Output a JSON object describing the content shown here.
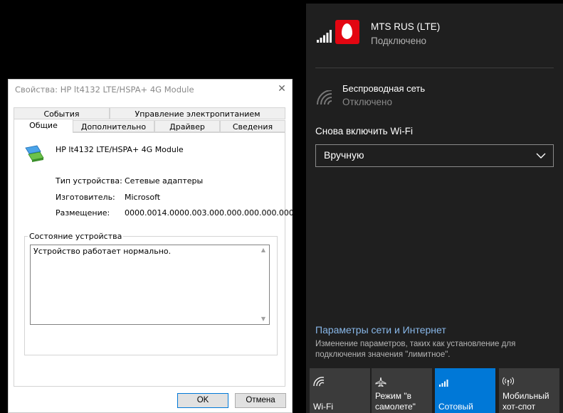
{
  "dialog": {
    "title": "Свойства: HP lt4132 LTE/HSPA+ 4G Module",
    "close_glyph": "✕",
    "tabs_row1": [
      "События",
      "Управление электропитанием"
    ],
    "tabs_row2": [
      "Общие",
      "Дополнительно",
      "Драйвер",
      "Сведения"
    ],
    "device_name": "HP lt4132 LTE/HSPA+ 4G Module",
    "properties": [
      {
        "label": "Тип устройства:",
        "value": "Сетевые адаптеры"
      },
      {
        "label": "Изготовитель:",
        "value": "Microsoft"
      },
      {
        "label": "Размещение:",
        "value": "0000.0014.0000.003.000.000.000.000.000"
      }
    ],
    "status_group_label": "Состояние устройства",
    "status_text": "Устройство работает нормально.",
    "ok_label": "OK",
    "cancel_label": "Отмена"
  },
  "flyout": {
    "mobile_network": {
      "name": "MTS RUS (LTE)",
      "status": "Подключено",
      "brand_color": "#e30611"
    },
    "wifi": {
      "name": "Беспроводная сеть",
      "status": "Отключено"
    },
    "reenable_label": "Снова включить Wi-Fi",
    "reenable_value": "Вручную",
    "settings_link": "Параметры сети и Интернет",
    "settings_desc": "Изменение параметров, таких как установление для подключения значения \"лимитное\".",
    "quick_actions": [
      {
        "label": "Wi-Fi",
        "icon": "wifi-icon",
        "active": false
      },
      {
        "label": "Режим \"в самолете\"",
        "icon": "airplane-icon",
        "active": false
      },
      {
        "label": "Сотовый",
        "icon": "cellular-icon",
        "active": true
      },
      {
        "label": "Мобильный хот-спот",
        "icon": "hotspot-icon",
        "active": false
      }
    ],
    "accent_color": "#0078d7"
  }
}
